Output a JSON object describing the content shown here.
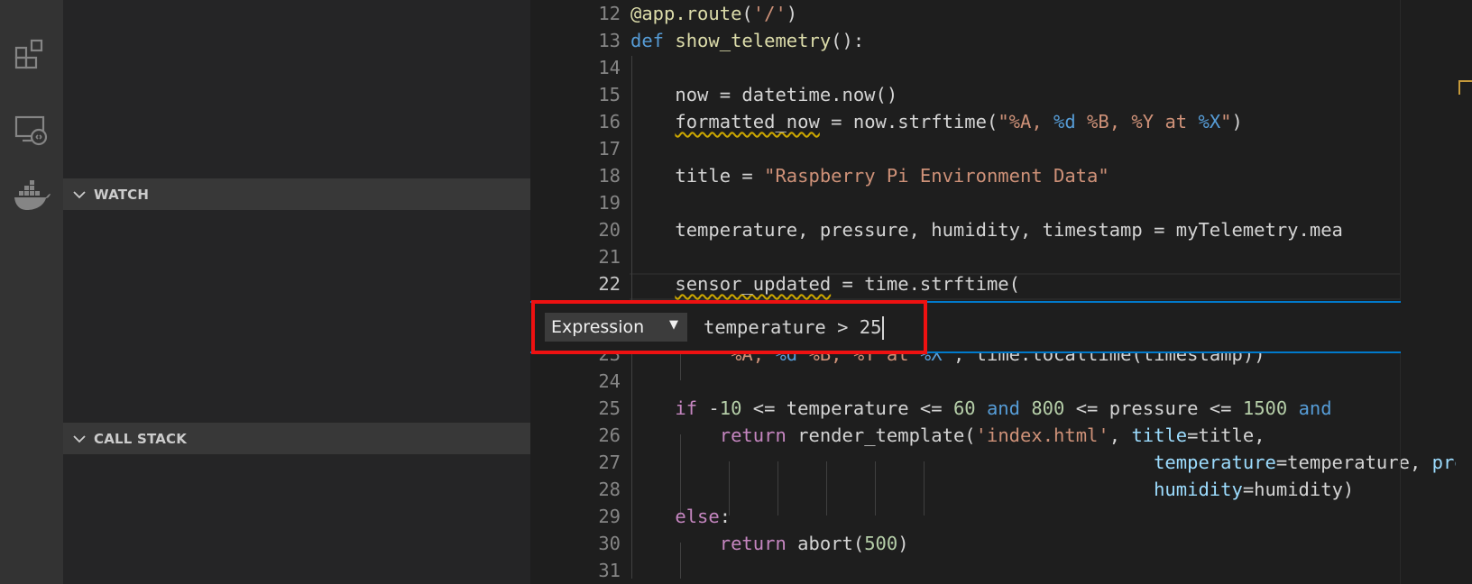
{
  "sidebar": {
    "sections": [
      {
        "title": "WATCH"
      },
      {
        "title": "CALL STACK"
      }
    ]
  },
  "activity_bar": {
    "icons": [
      "extensions-icon",
      "remote-explorer-icon",
      "docker-icon"
    ]
  },
  "editor": {
    "active_line": "22",
    "lines": [
      {
        "n": "12",
        "t": [
          [
            "fn",
            "@app.route"
          ],
          [
            "p",
            "("
          ],
          [
            "str",
            "'/'"
          ],
          [
            "p",
            ")"
          ]
        ]
      },
      {
        "n": "13",
        "t": [
          [
            "kw",
            "def"
          ],
          [
            "p",
            " "
          ],
          [
            "fn",
            "show_telemetry"
          ],
          [
            "p",
            "():"
          ]
        ]
      },
      {
        "n": "14",
        "t": []
      },
      {
        "n": "15",
        "t": [
          [
            "p",
            "    now = datetime.now()"
          ]
        ]
      },
      {
        "n": "16",
        "t": [
          [
            "p",
            "    "
          ],
          [
            "squig",
            "formatted_now"
          ],
          [
            "p",
            " = now.strftime("
          ],
          [
            "str",
            "\"%A, "
          ],
          [
            "esc",
            "%d"
          ],
          [
            "str",
            " %B, %Y at "
          ],
          [
            "esc",
            "%X"
          ],
          [
            "str",
            "\""
          ],
          [
            "p",
            ")"
          ]
        ]
      },
      {
        "n": "17",
        "t": []
      },
      {
        "n": "18",
        "t": [
          [
            "p",
            "    title = "
          ],
          [
            "str",
            "\"Raspberry Pi Environment Data\""
          ]
        ]
      },
      {
        "n": "19",
        "t": []
      },
      {
        "n": "20",
        "t": [
          [
            "p",
            "    temperature, pressure, humidity, timestamp = myTelemetry.mea"
          ]
        ]
      },
      {
        "n": "21",
        "t": []
      },
      {
        "n": "22",
        "t": [
          [
            "p",
            "    "
          ],
          [
            "squig",
            "sensor_updated"
          ],
          [
            "p",
            " = time.strftime("
          ]
        ]
      },
      {
        "n": "23",
        "t": [
          [
            "p",
            "        "
          ],
          [
            "str",
            "\"%A, "
          ],
          [
            "esc",
            "%d"
          ],
          [
            "str",
            " %B, %Y at "
          ],
          [
            "esc",
            "%X"
          ],
          [
            "str",
            "\""
          ],
          [
            "p",
            ", time.localtime(timestamp))"
          ]
        ]
      },
      {
        "n": "24",
        "t": []
      },
      {
        "n": "25",
        "t": [
          [
            "p",
            "    "
          ],
          [
            "ctl",
            "if"
          ],
          [
            "p",
            " -"
          ],
          [
            "num",
            "10"
          ],
          [
            "p",
            " <= temperature <= "
          ],
          [
            "num",
            "60"
          ],
          [
            "p",
            " "
          ],
          [
            "kw",
            "and"
          ],
          [
            "p",
            " "
          ],
          [
            "num",
            "800"
          ],
          [
            "p",
            " <= pressure <= "
          ],
          [
            "num",
            "1500"
          ],
          [
            "p",
            " "
          ],
          [
            "kw",
            "and"
          ]
        ]
      },
      {
        "n": "26",
        "t": [
          [
            "p",
            "        "
          ],
          [
            "ctl",
            "return"
          ],
          [
            "p",
            " render_template("
          ],
          [
            "str",
            "'index.html'"
          ],
          [
            "p",
            ", "
          ],
          [
            "param",
            "title"
          ],
          [
            "p",
            "=title,"
          ]
        ]
      },
      {
        "n": "27",
        "t": [
          [
            "p",
            "                                               "
          ],
          [
            "param",
            "temperature"
          ],
          [
            "p",
            "=temperature, "
          ],
          [
            "param",
            "pressure"
          ]
        ]
      },
      {
        "n": "28",
        "t": [
          [
            "p",
            "                                               "
          ],
          [
            "param",
            "humidity"
          ],
          [
            "p",
            "=humidity)"
          ]
        ]
      },
      {
        "n": "29",
        "t": [
          [
            "p",
            "    "
          ],
          [
            "ctl",
            "else"
          ],
          [
            "p",
            ":"
          ]
        ]
      },
      {
        "n": "30",
        "t": [
          [
            "p",
            "        "
          ],
          [
            "ctl",
            "return"
          ],
          [
            "p",
            " abort("
          ],
          [
            "num",
            "500"
          ],
          [
            "p",
            ")"
          ]
        ]
      },
      {
        "n": "31",
        "t": []
      }
    ]
  },
  "breakpoint_widget": {
    "type_select": "Expression",
    "type_arrow": "▼",
    "condition_value": "temperature > 25"
  }
}
